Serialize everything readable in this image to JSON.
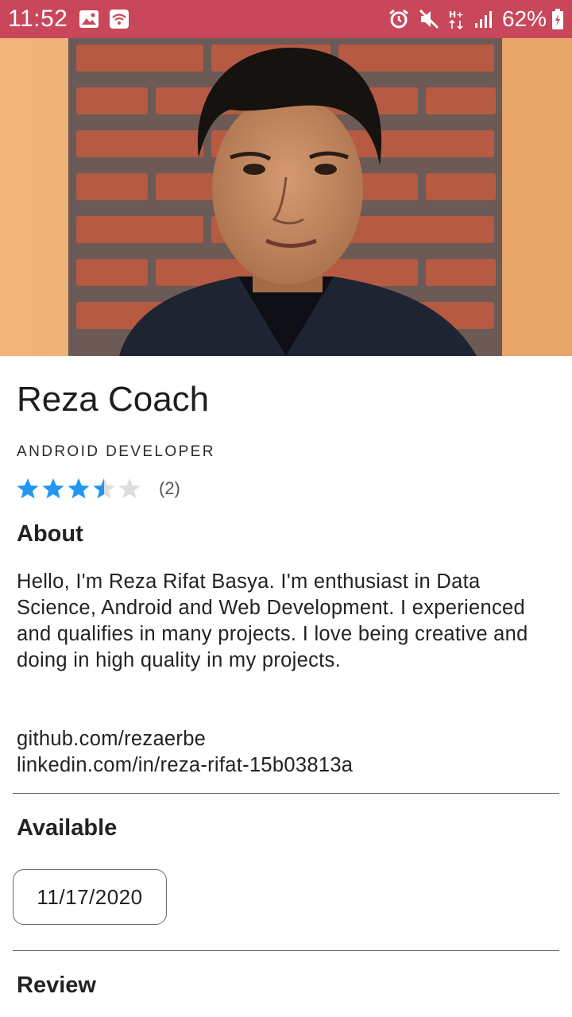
{
  "status_bar": {
    "time": "11:52",
    "battery": "62%",
    "icons": [
      "image-icon",
      "wifi-icon",
      "alarm-icon",
      "mute-icon",
      "hplus-icon",
      "signal-icon",
      "battery-icon"
    ],
    "bg_color": "#c8475a"
  },
  "profile": {
    "name": "Reza Coach",
    "role": "ANDROID DEVELOPER",
    "rating": 3.5,
    "rating_max": 5,
    "rating_count": "(2)",
    "star_color": "#2196f3"
  },
  "about": {
    "title": "About",
    "text": "Hello, I'm Reza Rifat Basya. I'm enthusiast in Data Science, Android and Web Development. I experienced and qualifies in many projects. I love being creative and doing in high quality in my projects.",
    "github": "github.com/rezaerbe",
    "linkedin": "linkedin.com/in/reza-rifat-15b03813a"
  },
  "available": {
    "title": "Available",
    "date": "11/17/2020"
  },
  "review": {
    "title": "Review"
  }
}
